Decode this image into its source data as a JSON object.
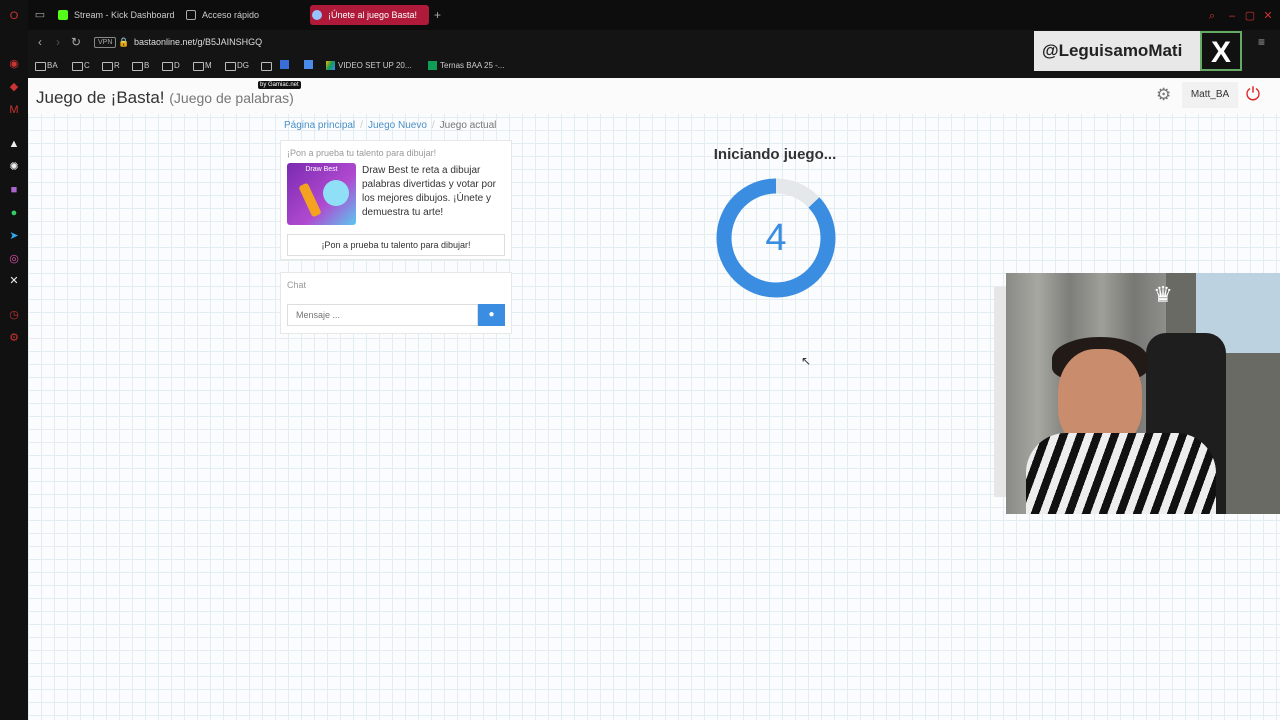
{
  "browser": {
    "tabs": [
      {
        "label": "Stream - Kick Dashboard",
        "icon": "kick-icon"
      },
      {
        "label": "Acceso rápido",
        "icon": "grid-icon"
      },
      {
        "label": "¡Únete al juego Basta!",
        "icon": "globe-icon",
        "active": true
      }
    ],
    "address": {
      "vpn_label": "VPN",
      "url": "bastaonline.net/g/B5JAINSHGQ"
    },
    "bookmarks": [
      "BA",
      "C",
      "R",
      "B",
      "D",
      "M",
      "DG",
      "",
      "VIDEO SET UP 20...",
      "Ternas BAA 25 -..."
    ]
  },
  "overlay": {
    "twitter_handle": "@LeguisamoMati",
    "x_logo": "X"
  },
  "header": {
    "title": "Juego de ¡Basta!",
    "subtitle": "(Juego de palabras)",
    "badge": "by Gamiac.net",
    "user": "Matt_BA"
  },
  "breadcrumb": {
    "home": "Página principal",
    "new_game": "Juego Nuevo",
    "current": "Juego actual"
  },
  "promo": {
    "title": "¡Pon a prueba tu talento para dibujar!",
    "image_label": "Draw Best",
    "text": "Draw Best te reta a dibujar palabras divertidas y votar por los mejores dibujos. ¡Únete y demuestra tu arte!",
    "button": "¡Pon a prueba tu talento para dibujar!"
  },
  "chat": {
    "title": "Chat",
    "placeholder": "Mensaje ..."
  },
  "game": {
    "status": "Iniciando juego...",
    "countdown": "4",
    "progress_fraction": 0.87
  },
  "colors": {
    "accent": "#3a8de0",
    "tab_active": "#b01a3a",
    "power": "#dd2222"
  }
}
